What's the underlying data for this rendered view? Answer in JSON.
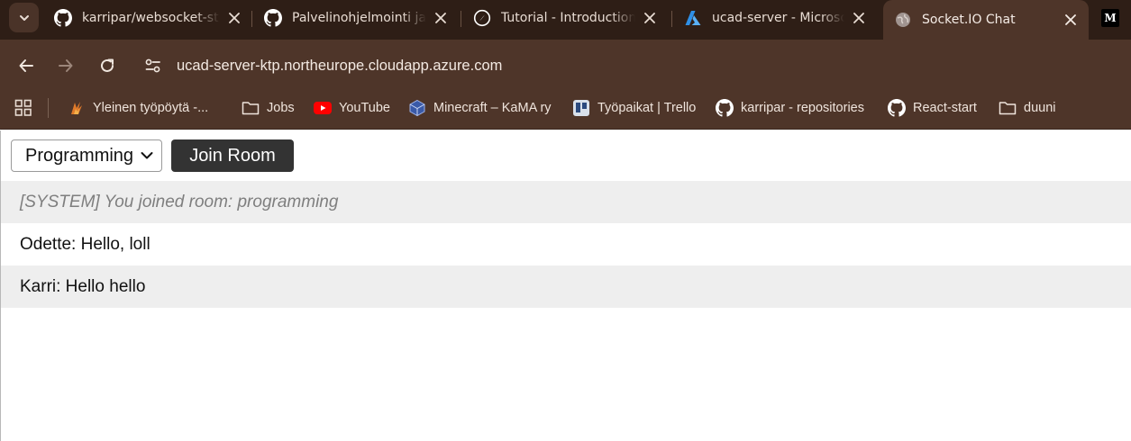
{
  "browser": {
    "tabs": [
      {
        "title": "karripar/websocket-st",
        "icon": "github-icon"
      },
      {
        "title": "Palvelinohjelmointi ja",
        "icon": "github-icon"
      },
      {
        "title": "Tutorial - Introduction",
        "icon": "compass-icon"
      },
      {
        "title": "ucad-server - Microso",
        "icon": "azure-icon"
      },
      {
        "title": "Socket.IO Chat",
        "icon": "globe-icon",
        "active": true
      },
      {
        "title": "M",
        "icon": "medium-icon"
      }
    ],
    "url": "ucad-server-ktp.northeurope.cloudapp.azure.com",
    "bookmarks": [
      {
        "label": "Yleinen työpöytä -...",
        "icon": "flame-icon"
      },
      {
        "label": "Jobs",
        "icon": "folder-icon"
      },
      {
        "label": "YouTube",
        "icon": "youtube-icon"
      },
      {
        "label": "Minecraft – KaMA ry",
        "icon": "cube-icon"
      },
      {
        "label": "Työpaikat | Trello",
        "icon": "trello-icon"
      },
      {
        "label": "karripar - repositories",
        "icon": "github-icon"
      },
      {
        "label": "React-start",
        "icon": "github-icon"
      },
      {
        "label": "duuni",
        "icon": "folder-icon"
      }
    ],
    "colors": {
      "frame": "#2e1e16",
      "toolbar": "#4e3529"
    }
  },
  "chat": {
    "room_select": {
      "selected": "Programming"
    },
    "join_label": "Join Room",
    "messages": [
      {
        "text": "[SYSTEM] You joined room: programming",
        "system": true
      },
      {
        "text": "Odette: Hello, loll",
        "system": false
      },
      {
        "text": "Karri: Hello hello",
        "system": false
      }
    ]
  }
}
